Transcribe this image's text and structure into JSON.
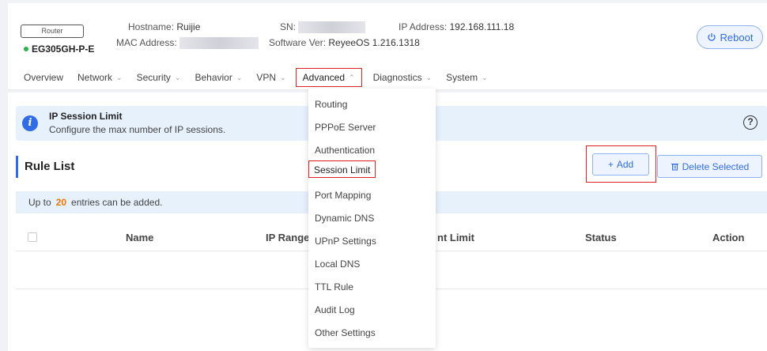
{
  "header": {
    "device_type": "Router",
    "device_name": "EG305GH-P-E",
    "hostname_label": "Hostname:",
    "hostname_value": "Ruijie",
    "mac_label": "MAC Address:",
    "sn_label": "SN:",
    "software_label": "Software Ver:",
    "software_value": "ReyeeOS 1.216.1318",
    "ip_label": "IP Address:",
    "ip_value": "192.168.111.18",
    "reboot_label": "Reboot",
    "status_color": "#2bb34a"
  },
  "nav": {
    "items": [
      {
        "label": "Overview"
      },
      {
        "label": "Network"
      },
      {
        "label": "Security"
      },
      {
        "label": "Behavior"
      },
      {
        "label": "VPN"
      },
      {
        "label": "Advanced"
      },
      {
        "label": "Diagnostics"
      },
      {
        "label": "System"
      }
    ]
  },
  "dropdown": {
    "items": [
      "Routing",
      "PPPoE Server",
      "Authentication",
      "Session Limit",
      "Port Mapping",
      "Dynamic DNS",
      "UPnP Settings",
      "Local DNS",
      "TTL Rule",
      "Audit Log",
      "Other Settings"
    ]
  },
  "notice": {
    "title": "IP Session Limit",
    "desc": "Configure the max number of IP sessions."
  },
  "rules": {
    "title": "Rule List",
    "add_label": "Add",
    "delete_label": "Delete Selected",
    "limit_prefix": "Up to",
    "limit_num": "20",
    "limit_suffix": "entries can be added.",
    "columns": [
      "Name",
      "IP Range",
      "nt Limit",
      "Status",
      "Action"
    ]
  },
  "colors": {
    "accent": "#2f6ce5",
    "highlight_border": "#e02020",
    "warning_number": "#f07800"
  }
}
